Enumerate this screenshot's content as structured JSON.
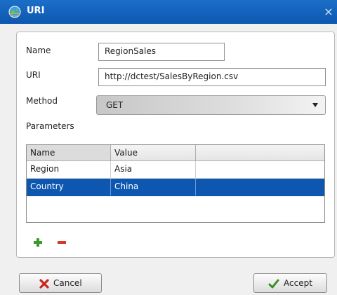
{
  "window": {
    "title": "URI",
    "title_icon": "globe-icon",
    "close_glyph": "×"
  },
  "form": {
    "name_label": "Name",
    "name_value": "RegionSales",
    "uri_label": "URI",
    "uri_value": "http://dctest/SalesByRegion.csv",
    "method_label": "Method",
    "method_value": "GET",
    "parameters_label": "Parameters"
  },
  "parameters_table": {
    "columns": [
      "Name",
      "Value",
      ""
    ],
    "rows": [
      {
        "name": "Region",
        "value": "Asia",
        "selected": false
      },
      {
        "name": "Country",
        "value": "China",
        "selected": true
      }
    ]
  },
  "toolbar": {
    "add_icon": "plus-icon",
    "remove_icon": "minus-icon"
  },
  "buttons": {
    "cancel_label": "Cancel",
    "accept_label": "Accept"
  },
  "colors": {
    "titlebar": "#0d57b0",
    "selection": "#0d57b0",
    "add": "#3c9a2a",
    "remove": "#d23a2a"
  }
}
